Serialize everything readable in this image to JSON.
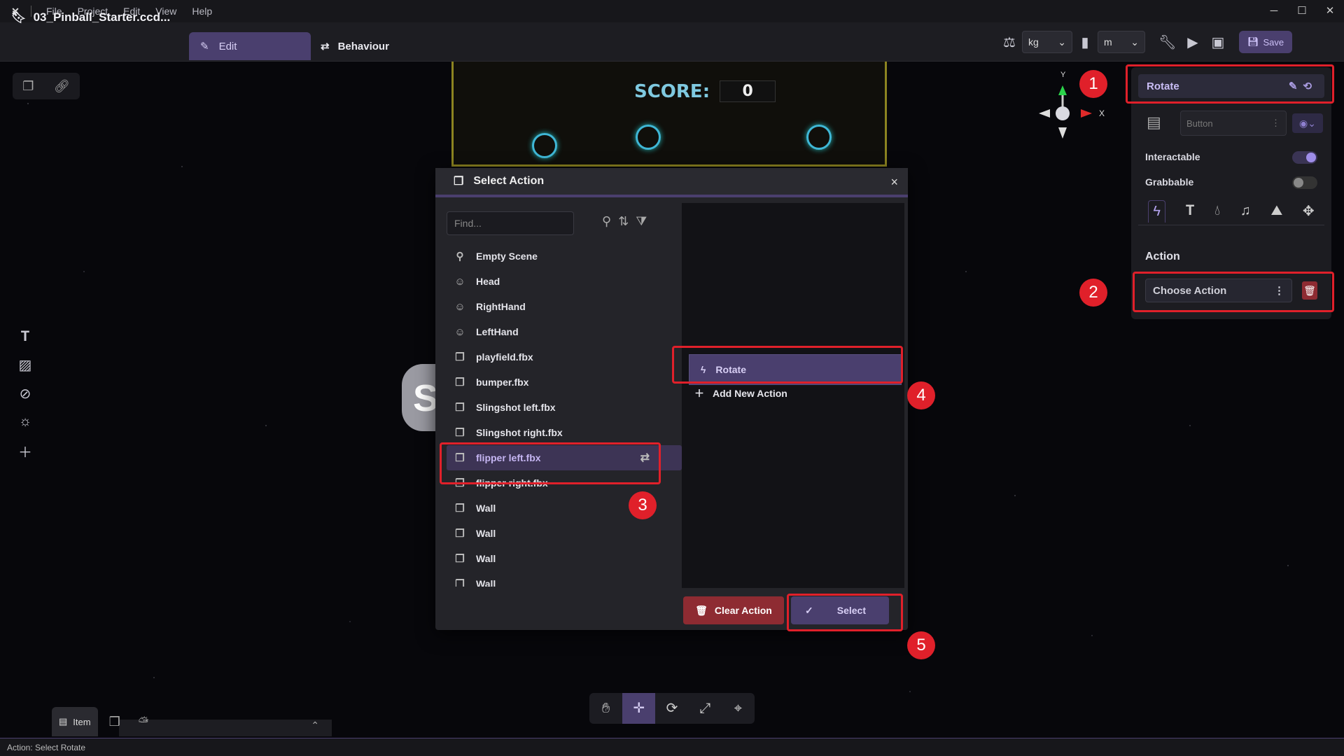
{
  "titlebar": {
    "logo": "✕",
    "menus": [
      "File",
      "Project",
      "Edit",
      "View",
      "Help"
    ],
    "minimize": "─",
    "maximize": "☐",
    "close": "✕"
  },
  "toolbar": {
    "project_name": "03_Pinball_Starter.ccd...",
    "tab_edit": "Edit",
    "tab_behaviour": "Behaviour",
    "mass_unit": "kg",
    "length_unit": "m",
    "save_label": "Save"
  },
  "scene": {
    "score_label": "SCORE:",
    "score_value": "0",
    "gizmo_y": "Y",
    "gizmo_x": "X",
    "partial_letter": "S"
  },
  "dialog": {
    "title": "Select Action",
    "close": "×",
    "search_placeholder": "Find...",
    "items": [
      {
        "label": "Empty Scene",
        "icon": "pin-icon",
        "glyph": "⚲"
      },
      {
        "label": "Head",
        "icon": "avatar-icon",
        "glyph": "☺"
      },
      {
        "label": "RightHand",
        "icon": "avatar-icon",
        "glyph": "☺"
      },
      {
        "label": "LeftHand",
        "icon": "avatar-icon",
        "glyph": "☺"
      },
      {
        "label": "playfield.fbx",
        "icon": "cube-icon",
        "glyph": "❒"
      },
      {
        "label": "bumper.fbx",
        "icon": "cube-icon",
        "glyph": "❒"
      },
      {
        "label": "Slingshot left.fbx",
        "icon": "cube-icon",
        "glyph": "❒"
      },
      {
        "label": "Slingshot right.fbx",
        "icon": "cube-icon",
        "glyph": "❒"
      },
      {
        "label": "flipper left.fbx",
        "icon": "cube-icon",
        "glyph": "❒",
        "selected": true
      },
      {
        "label": "flipper right.fbx",
        "icon": "cube-icon",
        "glyph": "❒"
      },
      {
        "label": "Wall",
        "icon": "cube-icon",
        "glyph": "❒"
      },
      {
        "label": "Wall",
        "icon": "cube-icon",
        "glyph": "❒"
      },
      {
        "label": "Wall",
        "icon": "cube-icon",
        "glyph": "❒"
      },
      {
        "label": "Wall",
        "icon": "cube-icon",
        "glyph": "❒"
      }
    ],
    "selected_action": "Rotate",
    "add_action": "Add New Action",
    "clear_button": "Clear Action",
    "select_button": "Select"
  },
  "properties": {
    "title": "Rotate",
    "type_field": "Button",
    "interactable_label": "Interactable",
    "interactable_on": true,
    "grabbable_label": "Grabbable",
    "grabbable_on": false,
    "section_label": "Action",
    "action_field": "Choose Action"
  },
  "annotations": [
    "1",
    "2",
    "3",
    "4",
    "5"
  ],
  "bottom": {
    "item_tab": "Item",
    "caret": "⌃"
  },
  "status": "Action: Select Rotate",
  "colors": {
    "accent": "#4a3f6e",
    "highlight": "#e0202a",
    "danger": "#8e2b32"
  }
}
